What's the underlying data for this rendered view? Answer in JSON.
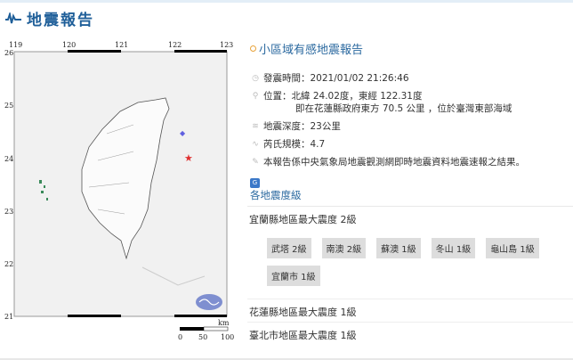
{
  "header": {
    "title": "地震報告"
  },
  "map": {
    "lon_ticks": [
      "119",
      "120",
      "121",
      "122",
      "123"
    ],
    "lat_ticks": [
      "26",
      "25",
      "24",
      "23",
      "22",
      "21"
    ],
    "scale_unit": "km",
    "scale_ticks": [
      "0",
      "50",
      "100"
    ]
  },
  "report": {
    "title": "小區域有感地震報告",
    "time": "發震時間：2021/01/02 21:26:46",
    "location": "位置：北緯 24.02度，東經 122.31度",
    "location_detail": "即在花蓮縣政府東方 70.5 公里 ，位於臺灣東部海域",
    "depth": "地震深度：23公里",
    "magnitude": "芮氏規模：4.7",
    "note": "本報告係中央氣象局地震觀測網即時地震資料地震速報之結果。",
    "intensity_heading": "各地震度級"
  },
  "regions": [
    {
      "label": "宜蘭縣地區最大震度 2級",
      "stations": [
        "武塔 2級",
        "南澳 2級",
        "蘇澳 1級",
        "冬山 1級",
        "龜山島 1級",
        "宜蘭市 1級"
      ]
    },
    {
      "label": "花蓮縣地區最大震度 1級"
    },
    {
      "label": "臺北市地區最大震度 1級"
    }
  ],
  "colors": {
    "brand": "#1f5f99",
    "epicenter": "#e03030"
  }
}
